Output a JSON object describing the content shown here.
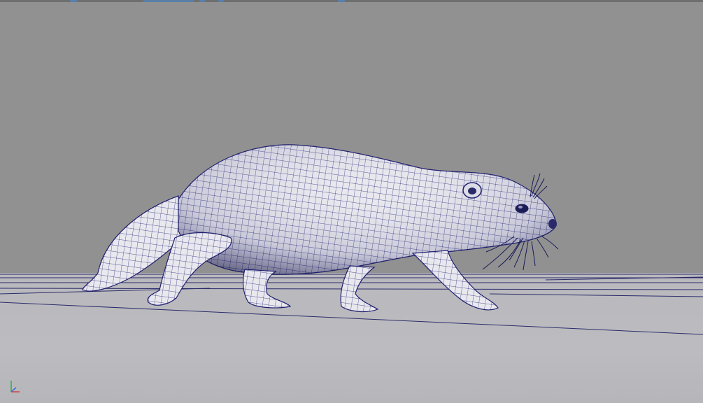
{
  "viewport": {
    "background_color": "#919191",
    "floor_color": "#bbbbbf",
    "wire_color": "#1f1f6e"
  },
  "scene": {
    "model": "otter-wireframe",
    "icons": {
      "axis": "axis-gizmo-icon"
    }
  }
}
